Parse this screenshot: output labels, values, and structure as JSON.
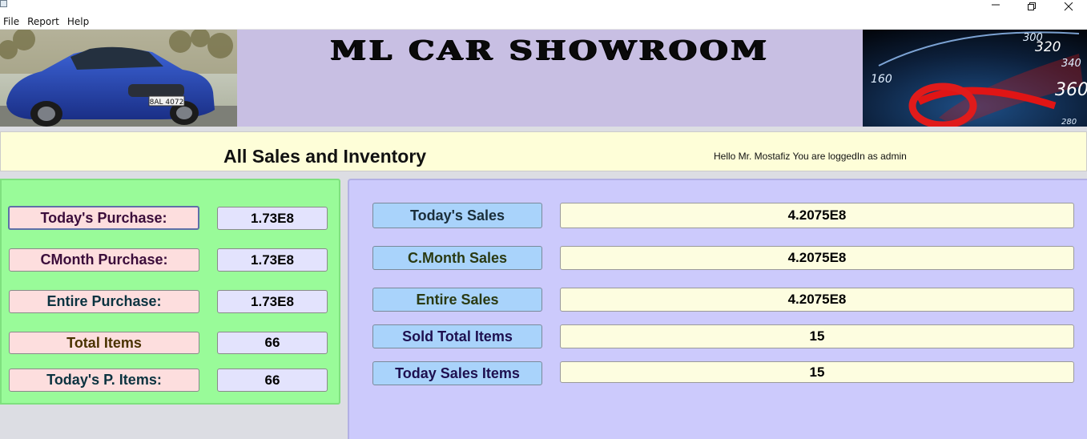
{
  "menu": {
    "items": [
      "File",
      "Report",
      "Help"
    ]
  },
  "banner": {
    "title": "ML CAR SHOWROOM"
  },
  "header": {
    "title": "All Sales and Inventory",
    "greeting": "Hello Mr. Mostafiz You are loggedIn as admin"
  },
  "purchase": {
    "items": [
      {
        "label": "Today's Purchase:",
        "value": "1.73E8"
      },
      {
        "label": "CMonth Purchase:",
        "value": "1.73E8"
      },
      {
        "label": "Entire Purchase:",
        "value": "1.73E8"
      },
      {
        "label": "Total Items",
        "value": "66"
      },
      {
        "label": "Today's P. Items:",
        "value": "66"
      }
    ]
  },
  "sales": {
    "items": [
      {
        "label": "Today's Sales",
        "value": "4.2075E8"
      },
      {
        "label": "C.Month Sales",
        "value": "4.2075E8"
      },
      {
        "label": "Entire Sales",
        "value": "4.2075E8"
      },
      {
        "label": "Sold Total Items",
        "value": "15"
      },
      {
        "label": "Today Sales Items",
        "value": "15"
      }
    ]
  },
  "speedo": {
    "ticks": [
      "300",
      "320",
      "340",
      "360",
      "160",
      "280"
    ]
  },
  "car": {
    "plate": "8AL 4072"
  },
  "colors": {
    "banner_bg": "#c8bfe3",
    "header_bg": "#fefed8",
    "left_panel_bg": "#99fb99",
    "right_panel_bg": "#cccafc",
    "pink_label": "#fddede",
    "blue_label": "#a9d3fb",
    "cream_value": "#fdfde0",
    "lavender_value": "#e3e3fd"
  }
}
